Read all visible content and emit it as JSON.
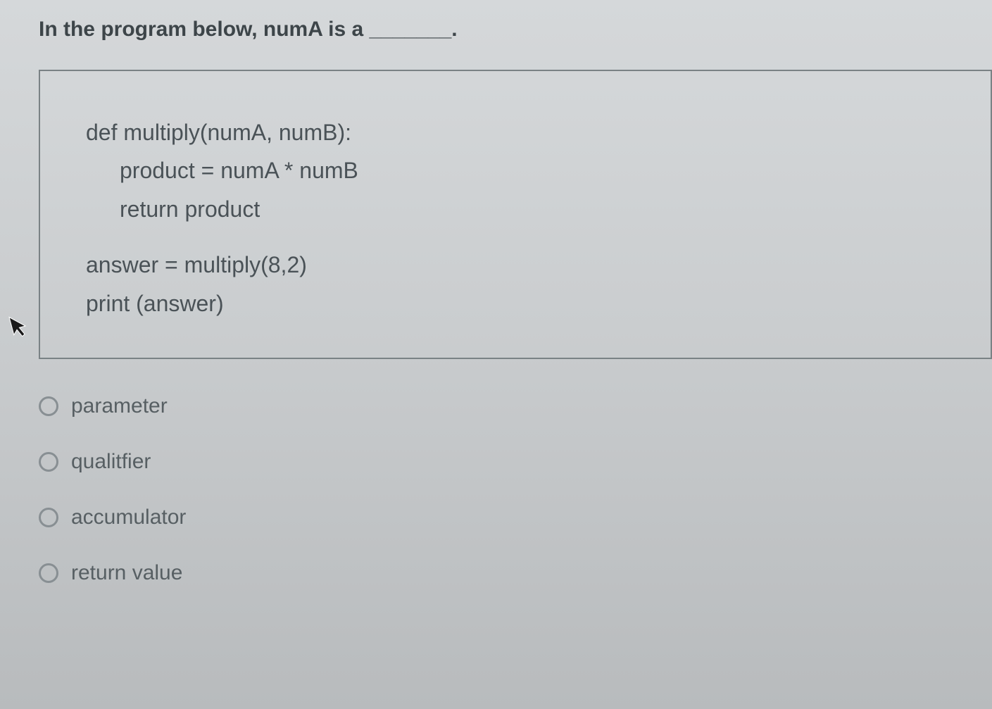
{
  "question": {
    "prompt": "In the program below, numA is a _______."
  },
  "code": {
    "line1": "def multiply(numA, numB):",
    "line2": "product = numA * numB",
    "line3": "return product",
    "line4": "answer = multiply(8,2)",
    "line5": "print (answer)"
  },
  "options": [
    {
      "label": "parameter"
    },
    {
      "label": "qualitfier"
    },
    {
      "label": "accumulator"
    },
    {
      "label": "return value"
    }
  ]
}
